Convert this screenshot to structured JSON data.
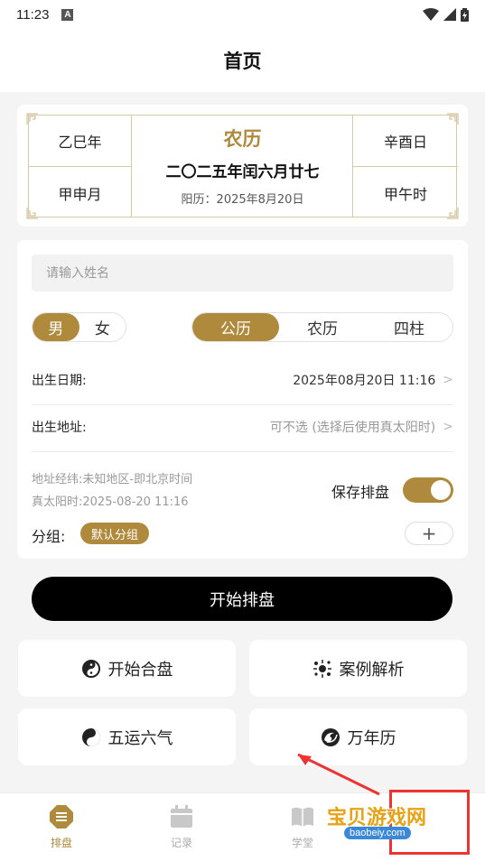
{
  "status_bar": {
    "time": "11:23",
    "badge": "A"
  },
  "header": {
    "title": "首页"
  },
  "calendar": {
    "year_gz": "乙巳年",
    "month_gz": "甲申月",
    "day_gz": "辛酉日",
    "hour_gz": "甲午时",
    "lunar_title": "农历",
    "lunar_date": "二〇二五年闰六月廿七",
    "solar_date": "阳历：2025年8月20日"
  },
  "form": {
    "name_placeholder": "请输入姓名",
    "name_value": "",
    "gender_options": [
      "男",
      "女"
    ],
    "gender_selected": "男",
    "calendar_options": [
      "公历",
      "农历",
      "四柱"
    ],
    "calendar_selected": "公历",
    "birth_date_label": "出生日期:",
    "birth_date_value": "2025年08月20日 11:16",
    "birth_place_label": "出生地址:",
    "birth_place_value": "可不选 (选择后使用真太阳时)",
    "coords_info": "地址经纬:未知地区-即北京时间",
    "solar_time_info": "真太阳时:2025-08-20 11:16",
    "save_label": "保存排盘",
    "save_enabled": true,
    "group_label": "分组:",
    "group_chip": "默认分组",
    "add_symbol": "+"
  },
  "start_button": "开始排盘",
  "features": [
    {
      "label": "开始合盘",
      "icon": "taiji-icon"
    },
    {
      "label": "案例解析",
      "icon": "sparkle-icon"
    },
    {
      "label": "五运六气",
      "icon": "yinyang-icon"
    },
    {
      "label": "万年历",
      "icon": "swirl-icon"
    }
  ],
  "bottom_nav": [
    {
      "label": "排盘",
      "icon": "menu-badge-icon",
      "active": true
    },
    {
      "label": "记录",
      "icon": "calendar-icon",
      "active": false
    },
    {
      "label": "学堂",
      "icon": "book-icon",
      "active": false
    }
  ],
  "watermark": {
    "text": "宝贝游戏网",
    "sub": "baobeiy.com"
  },
  "colors": {
    "accent": "#b08a3c",
    "border": "#d8c8a4",
    "background": "#f4f4f4"
  }
}
